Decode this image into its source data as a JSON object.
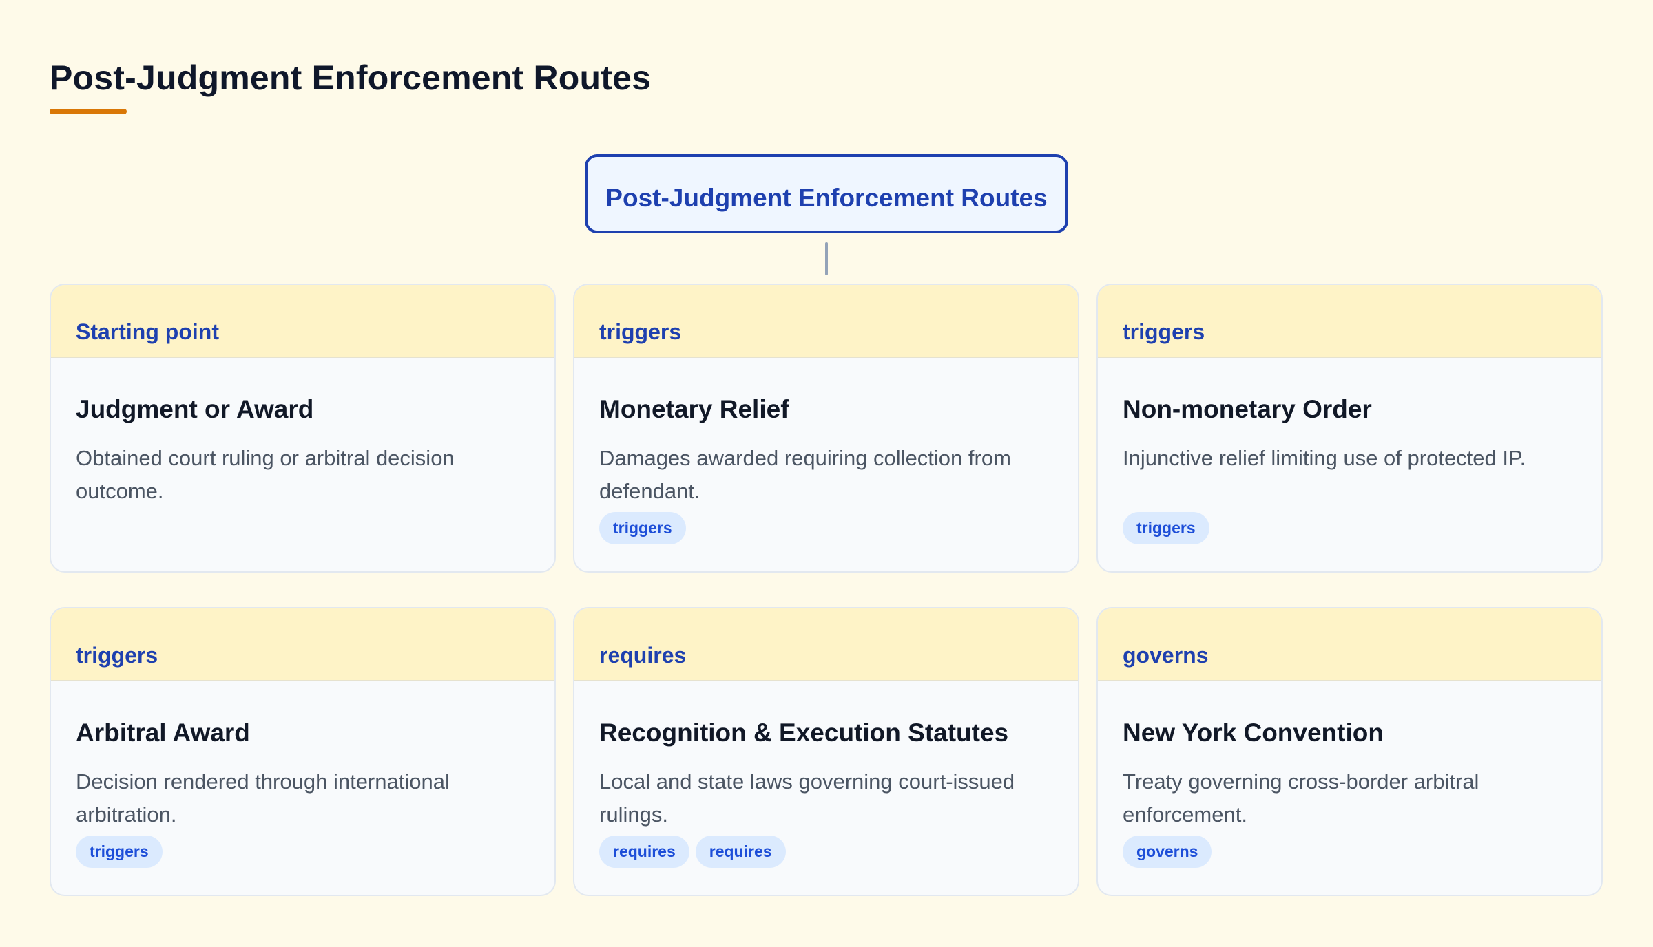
{
  "page": {
    "title": "Post-Judgment Enforcement Routes"
  },
  "root": {
    "label": "Post-Judgment Enforcement Routes"
  },
  "cards": [
    {
      "category": "Starting point",
      "title": "Judgment or Award",
      "description": "Obtained court ruling or arbitral decision outcome.",
      "tags": []
    },
    {
      "category": "triggers",
      "title": "Monetary Relief",
      "description": "Damages awarded requiring collection from defendant.",
      "tags": [
        "triggers"
      ]
    },
    {
      "category": "triggers",
      "title": "Non-monetary Order",
      "description": "Injunctive relief limiting use of protected IP.",
      "tags": [
        "triggers"
      ]
    },
    {
      "category": "triggers",
      "title": "Arbitral Award",
      "description": "Decision rendered through international arbitration.",
      "tags": [
        "triggers"
      ]
    },
    {
      "category": "requires",
      "title": "Recognition & Execution Statutes",
      "description": "Local and state laws governing court-issued rulings.",
      "tags": [
        "requires",
        "requires"
      ]
    },
    {
      "category": "governs",
      "title": "New York Convention",
      "description": "Treaty governing cross-border arbitral enforcement.",
      "tags": [
        "governs"
      ]
    }
  ],
  "colors": {
    "background": "#fefae9",
    "accent": "#d97706",
    "brand_blue": "#1e40af",
    "card_header": "#fef3c7",
    "tag_background": "#dbeafe",
    "tag_text": "#1d4ed8"
  }
}
